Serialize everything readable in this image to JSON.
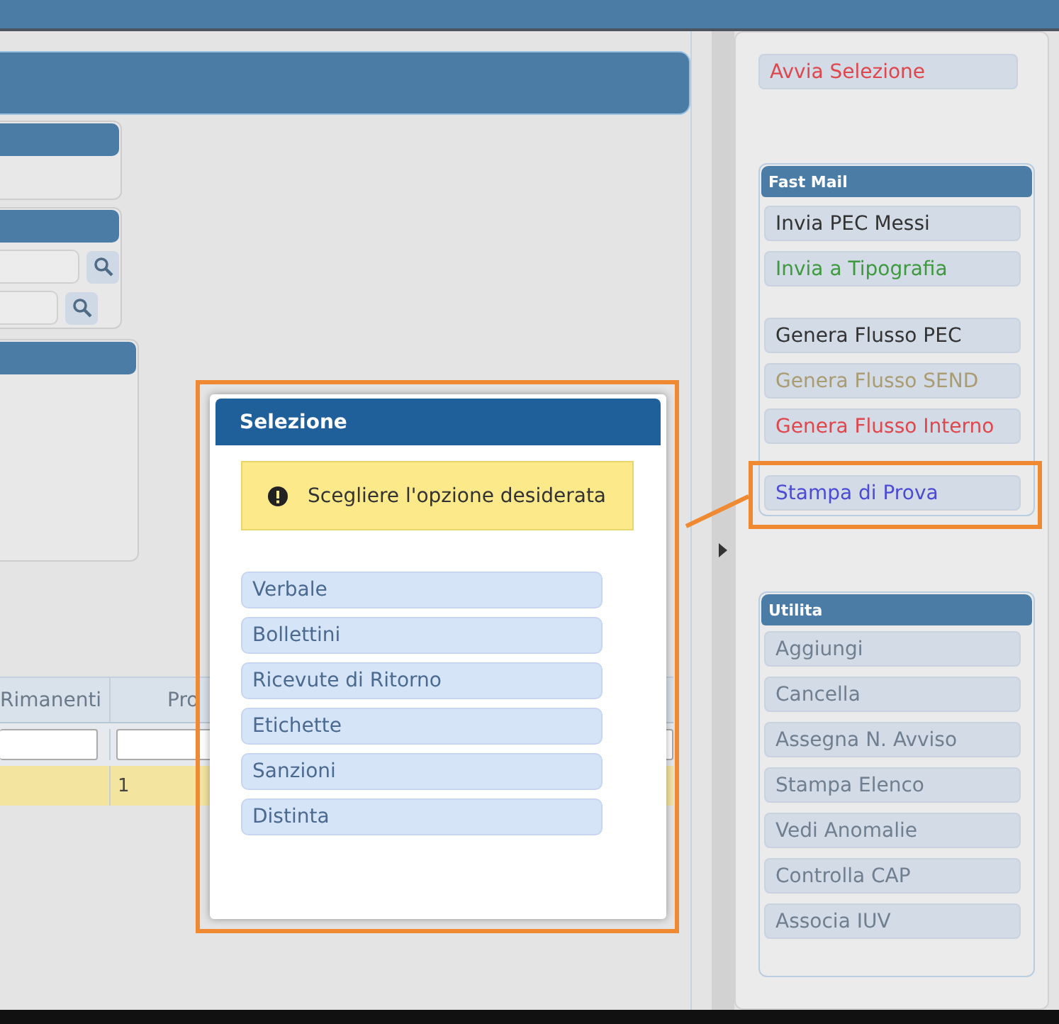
{
  "table": {
    "columns": [
      "Rimanenti",
      "Pro"
    ],
    "rows": [
      {
        "selected": true,
        "column_2": "1"
      }
    ]
  },
  "sidebar": {
    "top_button": {
      "label": "Avvia Selezione",
      "color": "#e0474c"
    },
    "groups": [
      {
        "title": "Fast Mail",
        "sections": [
          [
            {
              "label": "Invia PEC Messi",
              "color": "#333333",
              "highlighted": false
            },
            {
              "label": "Invia a Tipografia",
              "color": "#3f9a3f",
              "highlighted": false
            }
          ],
          [
            {
              "label": "Genera Flusso PEC",
              "color": "#333333",
              "highlighted": false
            },
            {
              "label": "Genera Flusso SEND",
              "color": "#aa9c72",
              "highlighted": false
            },
            {
              "label": "Genera Flusso Interno",
              "color": "#e0474c",
              "highlighted": false
            }
          ],
          [
            {
              "label": "Stampa di Prova",
              "color": "#4b4bd6",
              "highlighted": true
            }
          ]
        ]
      },
      {
        "title": "Utilita",
        "sections": [
          [
            {
              "label": "Aggiungi",
              "color": "#6f7f8f",
              "highlighted": false
            },
            {
              "label": "Cancella",
              "color": "#6f7f8f",
              "highlighted": false
            },
            {
              "label": "Assegna N. Avviso",
              "color": "#6f7f8f",
              "highlighted": false
            },
            {
              "label": "Stampa Elenco",
              "color": "#6f7f8f",
              "highlighted": false
            },
            {
              "label": "Vedi Anomalie",
              "color": "#6f7f8f",
              "highlighted": false
            },
            {
              "label": "Controlla CAP",
              "color": "#6f7f8f",
              "highlighted": false
            },
            {
              "label": "Associa IUV",
              "color": "#6f7f8f",
              "highlighted": false
            }
          ]
        ]
      }
    ]
  },
  "dialog": {
    "title": "Selezione",
    "highlighted": true,
    "notice": "Scegliere l'opzione desiderata",
    "options": [
      "Verbale",
      "Bollettini",
      "Ricevute di Ritorno",
      "Etichette",
      "Sanzioni",
      "Distinta"
    ]
  }
}
